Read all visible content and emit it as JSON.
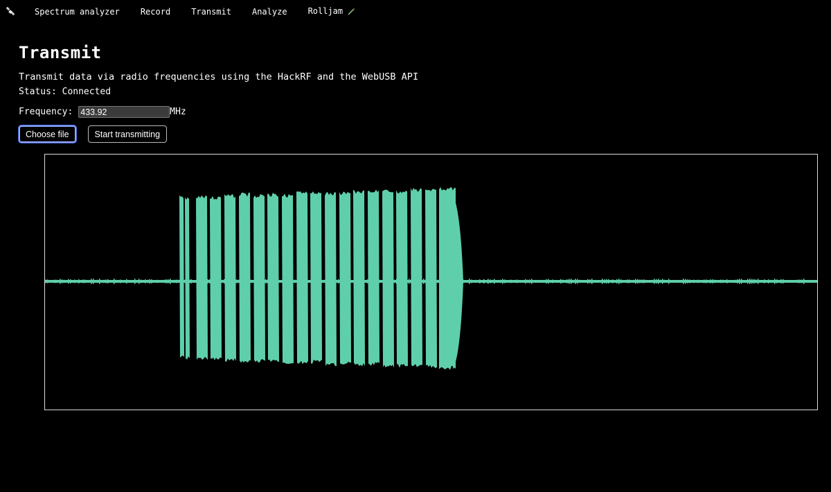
{
  "nav": {
    "logo_icon": "satellite-icon",
    "items": [
      {
        "label": "Spectrum analyzer"
      },
      {
        "label": "Record"
      },
      {
        "label": "Transmit"
      },
      {
        "label": "Analyze"
      },
      {
        "label": "Rolljam",
        "icon": "pencil-icon"
      }
    ]
  },
  "page": {
    "title": "Transmit",
    "description": "Transmit data via radio frequencies using the HackRF and the WebUSB API",
    "status": "Status: Connected"
  },
  "frequency": {
    "label": "Frequency:",
    "value": "433.92",
    "unit": "MHz"
  },
  "buttons": {
    "choose_file": "Choose file",
    "start": "Start transmitting"
  },
  "waveform": {
    "color": "#5fcfab",
    "border_color": "#dddddd"
  }
}
